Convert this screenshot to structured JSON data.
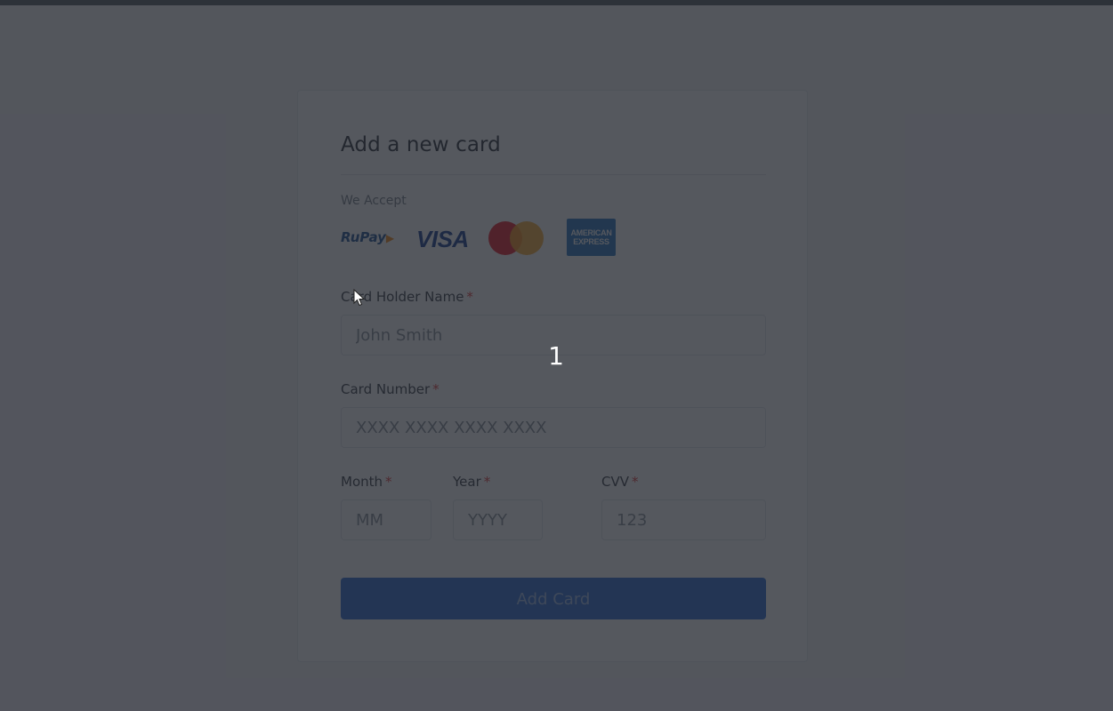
{
  "form": {
    "title": "Add a new card",
    "accept_label": "We Accept",
    "logos": {
      "rupay": "RuPay",
      "visa": "VISA",
      "amex_line1": "AMERICAN",
      "amex_line2": "EXPRESS"
    },
    "card_holder": {
      "label": "Card Holder Name",
      "required": "*",
      "placeholder": "John Smith"
    },
    "card_number": {
      "label": "Card Number",
      "required": "*",
      "placeholder": "XXXX XXXX XXXX XXXX"
    },
    "month": {
      "label": "Month",
      "required": "*",
      "placeholder": "MM"
    },
    "year": {
      "label": "Year",
      "required": "*",
      "placeholder": "YYYY"
    },
    "cvv": {
      "label": "CVV",
      "required": "*",
      "placeholder": "123"
    },
    "submit_label": "Add Card"
  },
  "overlay": {
    "counter": "1"
  },
  "icons": {
    "rupay": "rupay-logo-icon",
    "visa": "visa-logo-icon",
    "mastercard": "mastercard-logo-icon",
    "amex": "amex-logo-icon",
    "cursor": "mouse-cursor-icon"
  },
  "colors": {
    "accent": "#2f6fd6",
    "required": "#e03b3b",
    "overlay": "#20232c"
  }
}
